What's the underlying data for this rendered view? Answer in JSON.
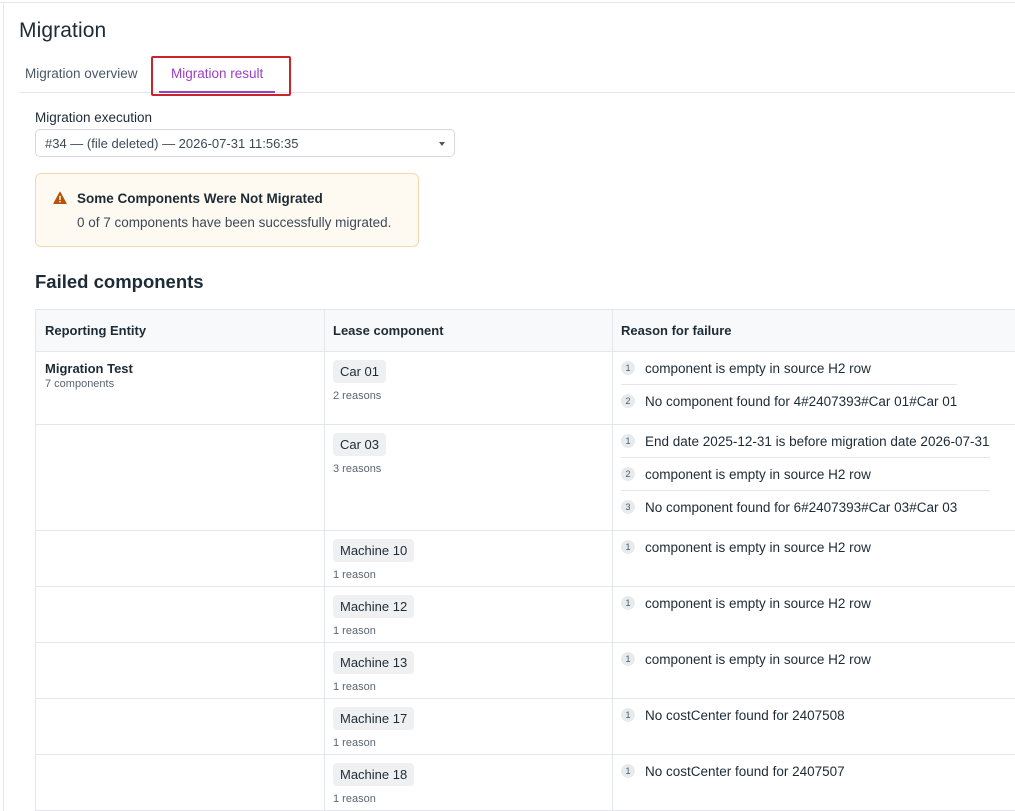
{
  "page": {
    "title": "Migration"
  },
  "tabs": [
    {
      "label": "Migration overview",
      "active": false
    },
    {
      "label": "Migration result",
      "active": true
    }
  ],
  "execution": {
    "label": "Migration execution",
    "selected": "#34 — (file deleted) — 2026-07-31 11:56:35"
  },
  "alert": {
    "title": "Some Components Were Not Migrated",
    "message": "0 of 7 components have been successfully migrated.",
    "icon": "warning-icon",
    "color": "#b45309"
  },
  "failed": {
    "title": "Failed components",
    "columns": [
      "Reporting Entity",
      "Lease component",
      "Reason for failure"
    ],
    "entity": {
      "name": "Migration Test",
      "count": "7 components"
    },
    "rows": [
      {
        "component": "Car 01",
        "count": "2 reasons",
        "reasons": [
          {
            "n": "1",
            "text": "component is empty in source H2 row"
          },
          {
            "n": "2",
            "text": "No component found for 4#2407393#Car 01#Car 01"
          }
        ]
      },
      {
        "component": "Car 03",
        "count": "3 reasons",
        "reasons": [
          {
            "n": "1",
            "text": "End date 2025-12-31 is before migration date 2026-07-31"
          },
          {
            "n": "2",
            "text": "component is empty in source H2 row"
          },
          {
            "n": "3",
            "text": "No component found for 6#2407393#Car 03#Car 03"
          }
        ]
      },
      {
        "component": "Machine 10",
        "count": "1 reason",
        "reasons": [
          {
            "n": "1",
            "text": "component is empty in source H2 row"
          }
        ]
      },
      {
        "component": "Machine 12",
        "count": "1 reason",
        "reasons": [
          {
            "n": "1",
            "text": "component is empty in source H2 row"
          }
        ]
      },
      {
        "component": "Machine 13",
        "count": "1 reason",
        "reasons": [
          {
            "n": "1",
            "text": "component is empty in source H2 row"
          }
        ]
      },
      {
        "component": "Machine 17",
        "count": "1 reason",
        "reasons": [
          {
            "n": "1",
            "text": "No costCenter found for 2407508"
          }
        ]
      },
      {
        "component": "Machine 18",
        "count": "1 reason",
        "reasons": [
          {
            "n": "1",
            "text": "No costCenter found for 2407507"
          }
        ]
      }
    ]
  },
  "colors": {
    "accent": "#9b3fc4",
    "focus_outline": "#c8242b"
  }
}
